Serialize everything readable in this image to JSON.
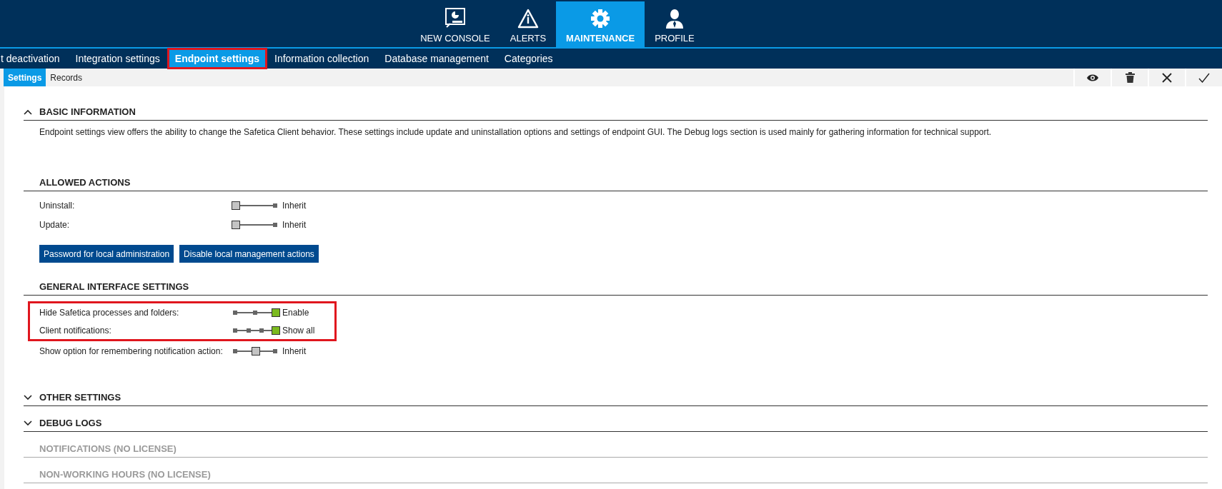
{
  "main_nav": [
    {
      "label": "NEW CONSOLE",
      "selected": false
    },
    {
      "label": "ALERTS",
      "selected": false
    },
    {
      "label": "MAINTENANCE",
      "selected": true
    },
    {
      "label": "PROFILE",
      "selected": false
    }
  ],
  "sub_nav": [
    {
      "label": "t deactivation",
      "selected": false,
      "highlighted": false
    },
    {
      "label": "Integration settings",
      "selected": false,
      "highlighted": false
    },
    {
      "label": "Endpoint settings",
      "selected": true,
      "highlighted": true
    },
    {
      "label": "Information collection",
      "selected": false,
      "highlighted": false
    },
    {
      "label": "Database management",
      "selected": false,
      "highlighted": false
    },
    {
      "label": "Categories",
      "selected": false,
      "highlighted": false
    }
  ],
  "view_tabs": [
    {
      "label": "Settings",
      "selected": true
    },
    {
      "label": "Records",
      "selected": false
    }
  ],
  "sections": [
    {
      "kind": "collapsible",
      "title": "BASIC INFORMATION",
      "expanded": true,
      "text": "Endpoint settings view offers the ability to change the Safetica Client behavior. These settings include update and uninstallation options and settings of endpoint GUI. The Debug logs section is used mainly for gathering information for technical support."
    },
    {
      "kind": "subsection",
      "title": "ALLOWED ACTIONS",
      "rows": [
        {
          "label": "Uninstall:",
          "kind": "two",
          "level": 0,
          "inherited": true,
          "value": "Inherit",
          "highlighted": false
        },
        {
          "label": "Update:",
          "kind": "two",
          "level": 0,
          "inherited": true,
          "value": "Inherit",
          "highlighted": false
        }
      ],
      "buttons": [
        "Password for local administration",
        "Disable local management actions"
      ]
    },
    {
      "kind": "subsection",
      "title": "GENERAL INTERFACE SETTINGS",
      "rows": [
        {
          "label": "Hide Safetica processes and folders:",
          "kind": "three",
          "level": 1,
          "inherited": false,
          "value": "Enable",
          "highlighted": true
        },
        {
          "label": "Client notifications:",
          "kind": "four",
          "level": 1,
          "inherited": false,
          "value": "Show all",
          "highlighted": true
        },
        {
          "label": "Show option for remembering notification action:",
          "kind": "three",
          "level": 0.5,
          "inherited": true,
          "value": "Inherit",
          "highlighted": false
        }
      ]
    },
    {
      "kind": "collapsible",
      "title": "OTHER SETTINGS",
      "expanded": false
    },
    {
      "kind": "collapsible",
      "title": "DEBUG LOGS",
      "expanded": false
    },
    {
      "kind": "unlicensed",
      "title": "NOTIFICATIONS (NO LICENSE)"
    },
    {
      "kind": "unlicensed",
      "title": "NON-WORKING HOURS (NO LICENSE)"
    }
  ]
}
